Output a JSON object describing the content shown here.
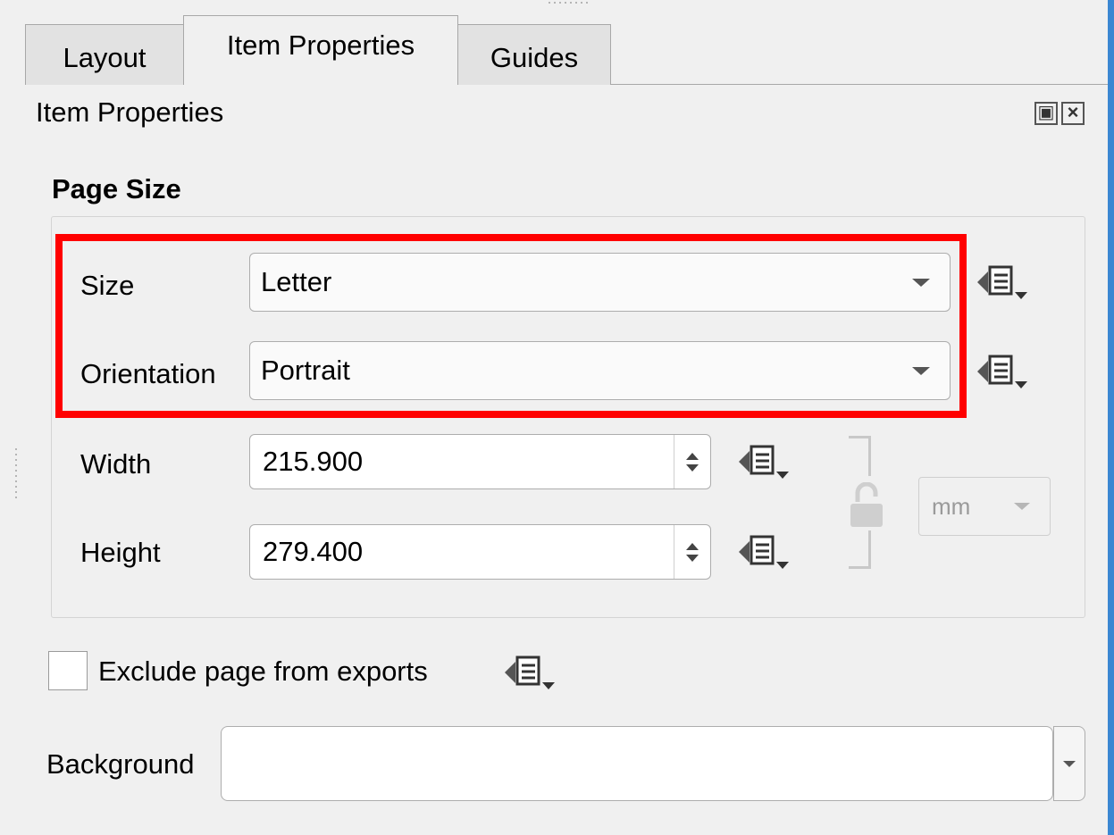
{
  "tabs": [
    {
      "label": "Layout",
      "active": false
    },
    {
      "label": "Item Properties",
      "active": true
    },
    {
      "label": "Guides",
      "active": false
    }
  ],
  "panel": {
    "title": "Item Properties"
  },
  "page_size": {
    "section_title": "Page Size",
    "size": {
      "label": "Size",
      "value": "Letter"
    },
    "orientation": {
      "label": "Orientation",
      "value": "Portrait"
    },
    "width": {
      "label": "Width",
      "value": "215.900"
    },
    "height": {
      "label": "Height",
      "value": "279.400"
    },
    "units": {
      "value": "mm"
    }
  },
  "exclude": {
    "label": "Exclude page from exports",
    "checked": false
  },
  "background": {
    "label": "Background",
    "value": ""
  },
  "colors": {
    "highlight": "#ff0000",
    "accent": "#3b87d2"
  },
  "icons": [
    "float-icon",
    "close-icon",
    "data-defined-override-icon",
    "lock-icon",
    "chevron-down-icon",
    "spin-up-icon",
    "spin-down-icon"
  ]
}
